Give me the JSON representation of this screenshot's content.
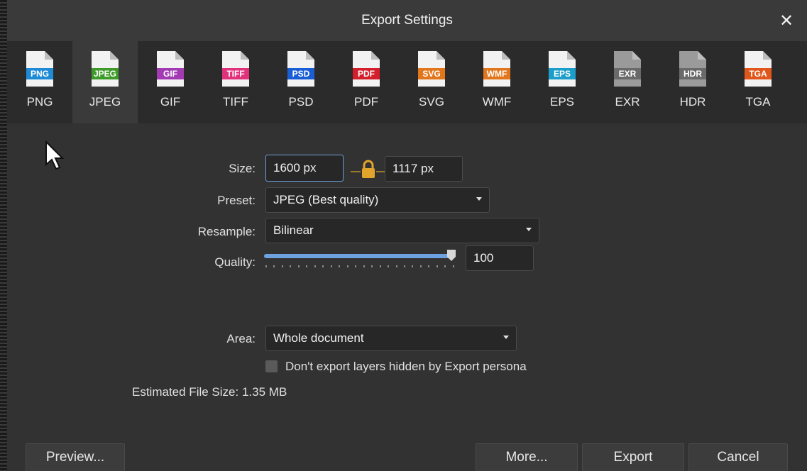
{
  "dialog": {
    "title": "Export Settings"
  },
  "formats": [
    {
      "name": "PNG",
      "label": "PNG",
      "color": "#1e8ad6",
      "active": false
    },
    {
      "name": "JPEG",
      "label": "JPEG",
      "color": "#3e9b2a",
      "active": true
    },
    {
      "name": "GIF",
      "label": "GIF",
      "color": "#a23bb3",
      "active": false
    },
    {
      "name": "TIFF",
      "label": "TIFF",
      "color": "#e0317a",
      "active": false
    },
    {
      "name": "PSD",
      "label": "PSD",
      "color": "#1a5ed6",
      "active": false
    },
    {
      "name": "PDF",
      "label": "PDF",
      "color": "#d31f2c",
      "active": false
    },
    {
      "name": "SVG",
      "label": "SVG",
      "color": "#e2761c",
      "active": false
    },
    {
      "name": "WMF",
      "label": "WMF",
      "color": "#e2761c",
      "active": false
    },
    {
      "name": "EPS",
      "label": "EPS",
      "color": "#1b9ec9",
      "active": false
    },
    {
      "name": "EXR",
      "label": "EXR",
      "color": "#6a6a6a",
      "active": false
    },
    {
      "name": "HDR",
      "label": "HDR",
      "color": "#6a6a6a",
      "active": false
    },
    {
      "name": "TGA",
      "label": "TGA",
      "color": "#e1571b",
      "active": false
    }
  ],
  "form": {
    "size_label": "Size:",
    "width_value": "1600 px",
    "height_value": "1117 px",
    "preset_label": "Preset:",
    "preset_value": "JPEG (Best quality)",
    "resample_label": "Resample:",
    "resample_value": "Bilinear",
    "quality_label": "Quality:",
    "quality_value": "100",
    "quality_fraction": 1.0,
    "area_label": "Area:",
    "area_value": "Whole document",
    "hidden_layers_label": "Don't export layers hidden by Export persona",
    "estimated_size_label": "Estimated File Size:",
    "estimated_size_value": "1.35 MB"
  },
  "buttons": {
    "preview": "Preview...",
    "more": "More...",
    "export": "Export",
    "cancel": "Cancel"
  },
  "colors": {
    "accent": "#6da1e0",
    "lock": "#e0a52a"
  }
}
